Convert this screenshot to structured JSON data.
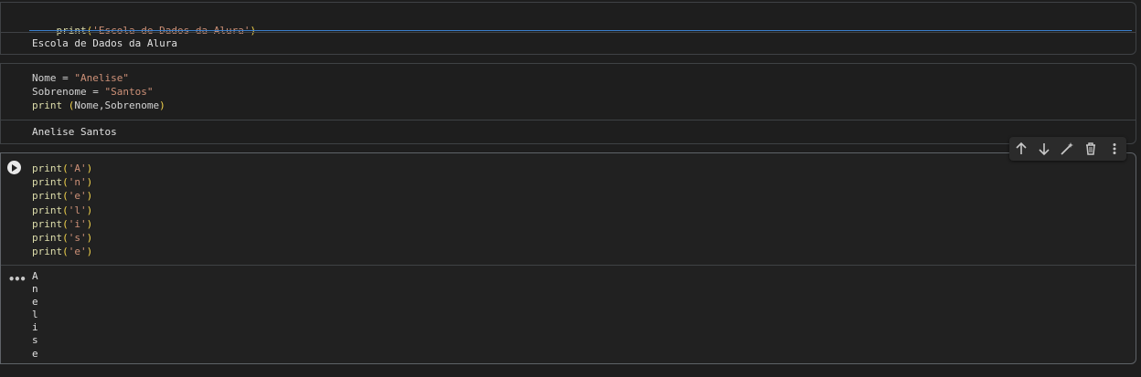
{
  "cells": [
    {
      "code": [
        {
          "fn": "print",
          "open": "(",
          "arg": "'Escola de Dados da Alura'",
          "close": ")"
        }
      ],
      "output": "Escola de Dados da Alura"
    },
    {
      "code": [
        {
          "var": "Nome",
          "op": " = ",
          "str": "\"Anelise\""
        },
        {
          "var": "Sobrenome",
          "op": " = ",
          "str": "\"Santos\""
        },
        {
          "fn": "print",
          "space": " ",
          "open": "(",
          "args": "Nome,Sobrenome",
          "close": ")"
        }
      ],
      "output": "Anelise Santos"
    },
    {
      "code": [
        {
          "fn": "print",
          "open": "(",
          "arg": "'A'",
          "close": ")"
        },
        {
          "fn": "print",
          "open": "(",
          "arg": "'n'",
          "close": ")"
        },
        {
          "fn": "print",
          "open": "(",
          "arg": "'e'",
          "close": ")"
        },
        {
          "fn": "print",
          "open": "(",
          "arg": "'l'",
          "close": ")"
        },
        {
          "fn": "print",
          "open": "(",
          "arg": "'i'",
          "close": ")"
        },
        {
          "fn": "print",
          "open": "(",
          "arg": "'s'",
          "close": ")"
        },
        {
          "fn": "print",
          "open": "(",
          "arg": "'e'",
          "close": ")"
        }
      ],
      "output_lines": [
        "A",
        "n",
        "e",
        "l",
        "i",
        "s",
        "e"
      ],
      "more_output": "•••"
    }
  ],
  "toolbar": {
    "icons": [
      "arrow-up-icon",
      "arrow-down-icon",
      "edit-magic-icon",
      "delete-icon",
      "more-vert-icon"
    ]
  },
  "colors": {
    "function": "#dcdcaa",
    "string": "#ce9178",
    "paren": "#f2d34c",
    "focus": "#3a7fcc"
  }
}
